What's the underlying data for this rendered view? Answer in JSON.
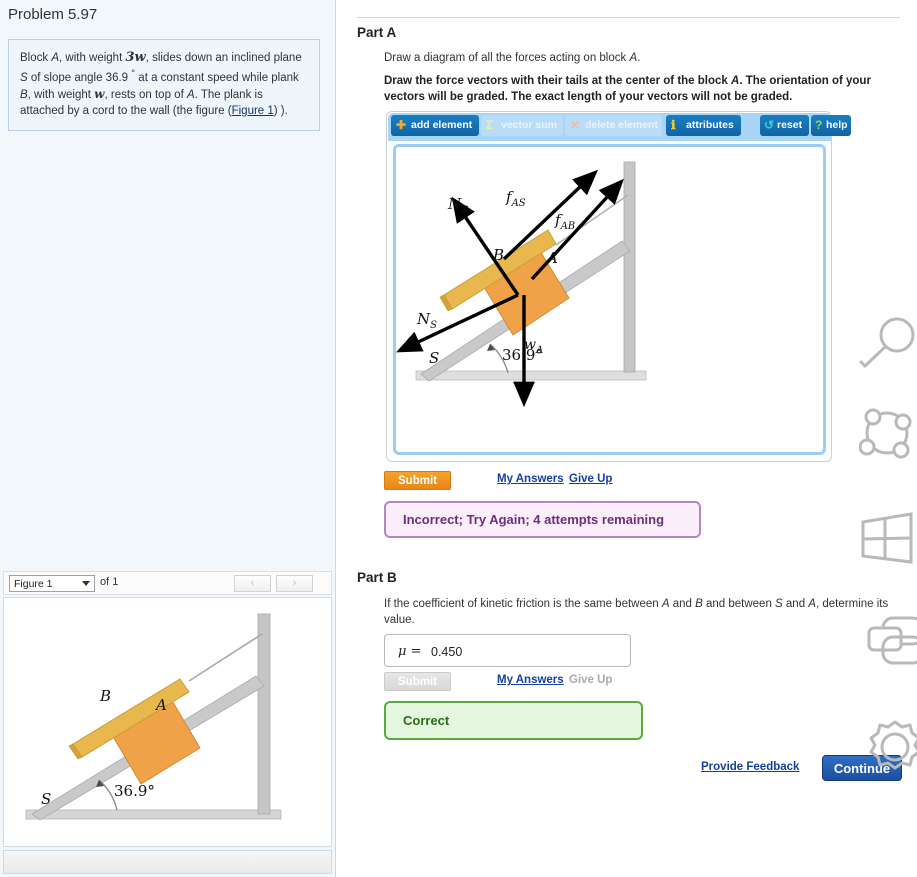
{
  "left": {
    "problem_title": "Problem 5.97",
    "statement_parts": {
      "p1": "Block ",
      "blockA": "A",
      "p2": ", with weight ",
      "weight3w": "3w",
      "p3": ", slides down an inclined plane ",
      "planeS": "S",
      "p4": " of slope angle 36.9 ",
      "deg": "°",
      "p5": " at a constant speed while plank ",
      "plankB": "B",
      "p6": ", with weight ",
      "weightw": "w",
      "p7": ", rests on top of ",
      "blockA2": "A",
      "p8": ". The plank is attached by a cord to the wall (the figure (",
      "figure_link": "Figure 1",
      "p9": ") )."
    },
    "figure_panel": {
      "select_value": "Figure 1",
      "of_label": "of 1",
      "prev_label": "‹",
      "next_label": "›",
      "figure": {
        "label_B": "B",
        "label_A": "A",
        "label_S": "S",
        "angle": "36.9°"
      }
    }
  },
  "right": {
    "partA": {
      "title": "Part A",
      "instruction1_pre": "Draw a diagram of all the forces acting on block ",
      "instruction1_italic": "A",
      "instruction1_post": ".",
      "instruction2_a": "Draw the force vectors with their tails at the center of the block ",
      "instruction2_italic": "A",
      "instruction2_b": ". The orientation of your vectors will be graded. The exact length of your vectors will not be graded.",
      "toolbar": [
        {
          "label": "add element",
          "icon": "plus-icon",
          "glyph": "✚",
          "state": "on",
          "icon_color": "#f5a623"
        },
        {
          "label": "vector sum",
          "icon": "sigma-icon",
          "glyph": "Σ",
          "state": "off",
          "icon_color": "#e8f5a0"
        },
        {
          "label": "delete element",
          "icon": "x-icon",
          "glyph": "✕",
          "state": "off",
          "icon_color": "#f7b9a0"
        },
        {
          "label": "attributes",
          "icon": "info-icon",
          "glyph": "ℹ",
          "state": "on",
          "icon_color": "#f5d020"
        },
        {
          "label": "reset",
          "icon": "refresh-icon",
          "glyph": "↺",
          "state": "on",
          "icon_color": "#3ad4c8"
        },
        {
          "label": "help",
          "icon": "question-icon",
          "glyph": "?",
          "state": "on",
          "icon_color": "#8ddc4a"
        }
      ],
      "diagram": {
        "label_NB": "N",
        "label_NB_sub": "B",
        "label_NS": "N",
        "label_NS_sub": "S",
        "label_fAS": "f",
        "label_fAS_sub": "AS",
        "label_fAB": "f",
        "label_fAB_sub": "AB",
        "label_wA": "w",
        "label_wA_sub": "A",
        "label_A": "A",
        "label_B": "B",
        "label_S": "S",
        "angle": "36.9°"
      },
      "submit_label": "Submit",
      "my_answers_label": "My Answers",
      "give_up_label": "Give Up",
      "feedback": "Incorrect; Try Again; 4 attempts remaining"
    },
    "partB": {
      "title": "Part B",
      "instruction_a": "If the coefficient of kinetic friction is the same between ",
      "italic_A": "A",
      "instruction_b": " and ",
      "italic_B": "B",
      "instruction_c": " and between ",
      "italic_S": "S",
      "instruction_d": " and ",
      "italic_A2": "A",
      "instruction_e": ", determine its value.",
      "mu_symbol": "μ =",
      "mu_value": "0.450",
      "submit_label": "Submit",
      "my_answers_label": "My Answers",
      "give_up_label": "Give Up",
      "feedback": "Correct"
    },
    "footer": {
      "provide_feedback_label": "Provide Feedback",
      "continue_label": "Continue"
    },
    "watermark_icons": [
      "magnifier-icon",
      "molecule-icon",
      "window-grid-icon",
      "layers-icon",
      "gear-icon"
    ]
  },
  "colors": {
    "accent_orange": "#e8861a",
    "accent_blue": "#1d4f9e",
    "incorrect_purple": "#6d2f7c",
    "correct_green": "#2b6e18",
    "block_orange": "#f0a248",
    "plank_orange": "#e8b84f",
    "ramp_gray": "#bdbdbd"
  }
}
